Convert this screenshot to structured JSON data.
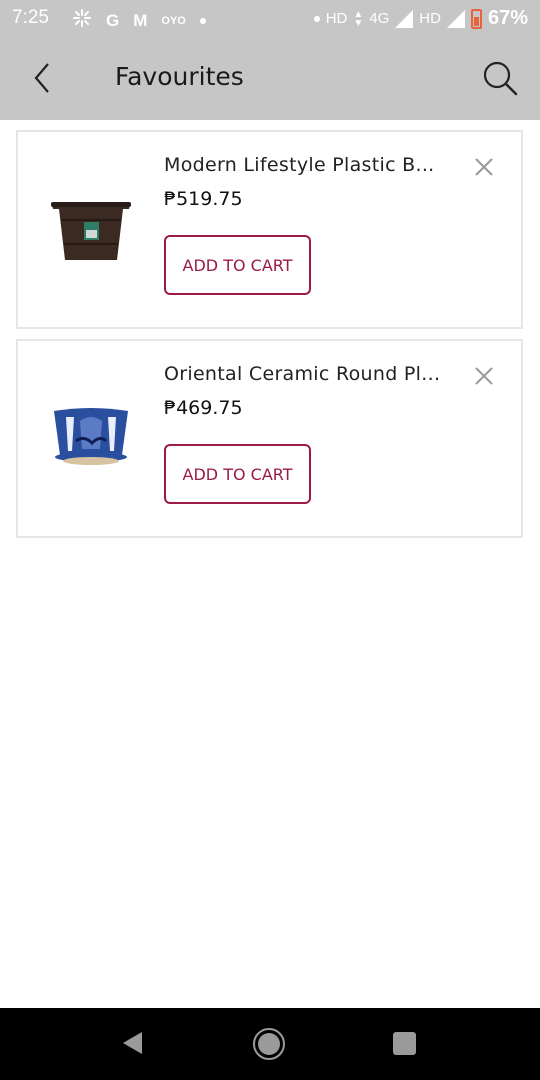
{
  "status_bar": {
    "time": "7:25",
    "left_icons": [
      "pinwheel-icon",
      "g-icon",
      "m-icon",
      "oyo-icon",
      "dot-icon"
    ],
    "oyo_text": "OYO",
    "g_text": "G",
    "m_text": "M",
    "hd1": "HD",
    "network": "4G",
    "hd2": "HD",
    "battery_percent": "67%",
    "battery_color": "#e8633b"
  },
  "app_bar": {
    "title": "Favourites",
    "back_icon": "chevron-left-icon",
    "search_icon": "search-icon"
  },
  "favourites": [
    {
      "name": "Modern Lifestyle Plastic B...",
      "price": "₱519.75",
      "button_label": "ADD TO CART",
      "image": "brown-plastic-pot"
    },
    {
      "name": "Oriental Ceramic Round Pl...",
      "price": "₱469.75",
      "button_label": "ADD TO CART",
      "image": "blue-white-ceramic-pot"
    }
  ],
  "colors": {
    "accent": "#9c1a4a",
    "header_bg": "#c6c6c6",
    "card_border": "#e6e6e6"
  },
  "nav_bar": {
    "buttons": [
      "back-triangle-icon",
      "home-circle-icon",
      "recents-square-icon"
    ]
  }
}
